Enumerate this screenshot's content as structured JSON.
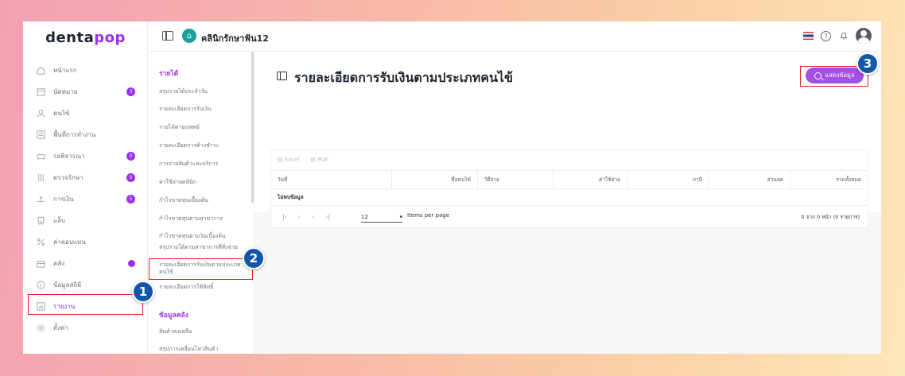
{
  "brand": {
    "prefix": "denta",
    "suffix": "pop",
    "accent": "#9b30e8"
  },
  "header": {
    "clinic_name": "คลินิกรักษาฟัน12",
    "help_icon": "?"
  },
  "sidebar": {
    "items": [
      {
        "label": "หน้าแรก",
        "icon": "home-icon",
        "badge": ""
      },
      {
        "label": "นัดหมาย",
        "icon": "calendar-icon",
        "badge": "3"
      },
      {
        "label": "คนไข้",
        "icon": "person-icon",
        "badge": ""
      },
      {
        "label": "พื้นที่การทำงาน",
        "icon": "workspace-icon",
        "badge": ""
      },
      {
        "label": "รอพิจารณา",
        "icon": "couch-icon",
        "badge": "0"
      },
      {
        "label": "ตรวจรักษา",
        "icon": "tools-icon",
        "badge": "5"
      },
      {
        "label": "การเงิน",
        "icon": "money-icon",
        "badge": "5"
      },
      {
        "label": "แล็บ",
        "icon": "tooth-icon",
        "badge": ""
      },
      {
        "label": "ค่าตอบแทน",
        "icon": "percent-icon",
        "badge": ""
      },
      {
        "label": "คลัง",
        "icon": "box-icon",
        "badge": "dot"
      },
      {
        "label": "ข้อมูลสถิติ",
        "icon": "info-icon",
        "badge": ""
      },
      {
        "label": "รายงาน",
        "icon": "report-icon",
        "badge": ""
      },
      {
        "label": "ตั้งค่า",
        "icon": "gear-icon",
        "badge": ""
      }
    ]
  },
  "submenu": {
    "income_heading": "รายได้",
    "income_items": [
      "สรุปรายได้ประจำวัน",
      "รายละเอียดการรับเงิน",
      "รายได้ตามแพทย์",
      "รายละเอียดการค้างชำระ",
      "การจ่ายสินค้าและบริการ",
      "ค่าใช้จ่ายคลินิก",
      "กำไรขาดทุนเบื้องต้น",
      "กำไรขาดทุนตามสาขาการ",
      "กำไรขาดทุนตามวันเบื้องต้น",
      "สรุปรายได้ตามสาขาการที่สั่งจ่าย",
      "รายละเอียดการรับเงินตามประเภทคนไข้",
      "รายละเอียดการใช้สิทธิ์"
    ],
    "stock_heading": "ข้อมูลคลัง",
    "stock_items": [
      "สินค้าคงเหลือ",
      "สรุปการเคลื่อนไหวสินค้า"
    ]
  },
  "main": {
    "title": "รายละเอียดการรับเงินตามประเภทคนไข้",
    "show_button": "แสดงข้อมูล",
    "export_excel": "Excel",
    "export_pdf": "PDF",
    "columns": [
      "วันที่",
      "ชื่อคนไข้",
      "วิธีจ่าย",
      "ค่าใช้จ่าย",
      "ภาษี",
      "ส่วนลด",
      "รวมทั้งหมด"
    ],
    "no_data": "ไม่พบข้อมูล",
    "page_size": "12",
    "items_per_page": "Items per page",
    "count_text": "0 จาก 0 หน้า (0 รายการ)"
  },
  "annotations": {
    "step1": "1",
    "step2": "2",
    "step3": "3",
    "color": "#e2231a"
  }
}
